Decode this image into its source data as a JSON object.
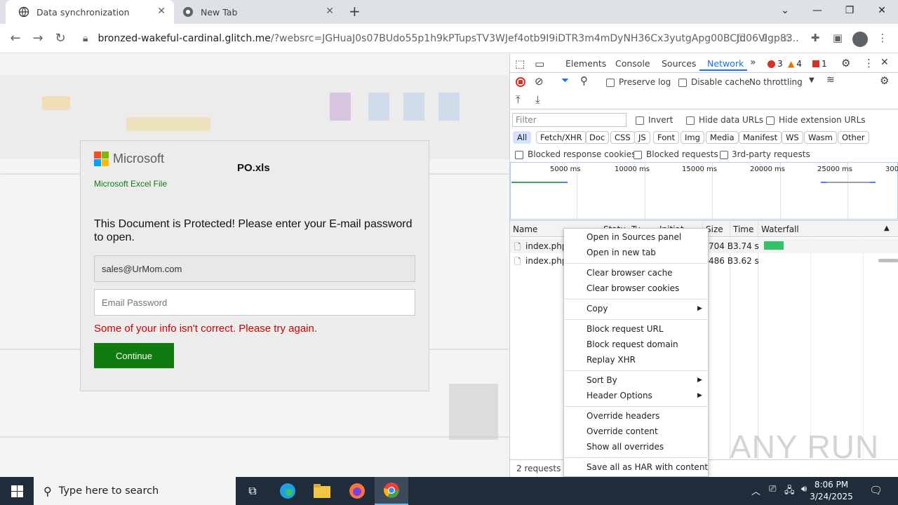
{
  "browser": {
    "tabs": [
      {
        "title": "Data synchronization",
        "active": true
      },
      {
        "title": "New Tab",
        "active": false
      }
    ],
    "url_host": "bronzed-wakeful-cardinal.glitch.me",
    "url_rest": "/?websrc=JGHuaJ0s07BUdo55p1h9kPTupsTV3WJef4otb9I9iDTR3m4mDyNH36Cx3yutgApg00BCJd06Vigp83..."
  },
  "page": {
    "brand": "Microsoft",
    "file_name": "PO.xls",
    "file_type": "Microsoft Excel File",
    "prompt": "This Document is Protected! Please enter your E-mail password to open.",
    "email_value": "sales@UrMom.com",
    "password_placeholder": "Email Password",
    "error": "Some of your info isn't correct. Please try again.",
    "continue_label": "Continue"
  },
  "devtools": {
    "tabs": [
      "Elements",
      "Console",
      "Sources",
      "Network"
    ],
    "active_tab": "Network",
    "errors": "3",
    "warnings": "4",
    "issues": "1",
    "preserve_log": "Preserve log",
    "disable_cache": "Disable cache",
    "throttling": "No throttling",
    "filter_placeholder": "Filter",
    "invert": "Invert",
    "hide_data_urls": "Hide data URLs",
    "hide_extension_urls": "Hide extension URLs",
    "type_filters": [
      "All",
      "Fetch/XHR",
      "Doc",
      "CSS",
      "JS",
      "Font",
      "Img",
      "Media",
      "Manifest",
      "WS",
      "Wasm",
      "Other"
    ],
    "blocked_response_cookies": "Blocked response cookies",
    "blocked_requests": "Blocked requests",
    "third_party_requests": "3rd-party requests",
    "timeline_ticks": [
      "5000 ms",
      "10000 ms",
      "15000 ms",
      "20000 ms",
      "25000 ms",
      "300"
    ],
    "columns": {
      "name": "Name",
      "status": "Statu",
      "type": "Ty",
      "initiator": "Initiat",
      "size": "Size",
      "time": "Time",
      "waterfall": "Waterfall"
    },
    "rows": [
      {
        "name": "index.php",
        "size": "704 B",
        "time": "3.74 s"
      },
      {
        "name": "index.php",
        "size": "486 B",
        "time": "3.62 s"
      }
    ],
    "summary": "2 requests"
  },
  "context_menu": {
    "items": [
      "Open in Sources panel",
      "Open in new tab",
      "Clear browser cache",
      "Clear browser cookies",
      "Copy",
      "Block request URL",
      "Block request domain",
      "Replay XHR",
      "Sort By",
      "Header Options",
      "Override headers",
      "Override content",
      "Show all overrides",
      "Save all as HAR with content"
    ]
  },
  "taskbar": {
    "search_placeholder": "Type here to search",
    "time": "8:06 PM",
    "date": "3/24/2025"
  },
  "watermark": "ANY RUN",
  "colors": {
    "excel_green": "#107c10",
    "error_red": "#cc0000",
    "devtools_blue": "#1a73e8"
  }
}
